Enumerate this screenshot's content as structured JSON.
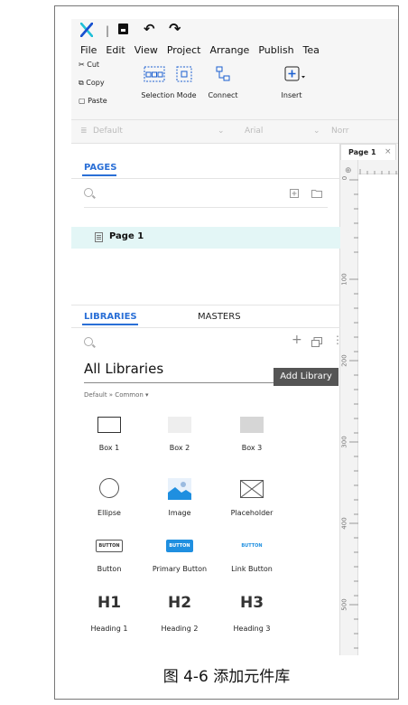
{
  "toolbar": {
    "separator": "|",
    "undo_glyph": "↶",
    "redo_glyph": "↷"
  },
  "menu": [
    "File",
    "Edit",
    "View",
    "Project",
    "Arrange",
    "Publish",
    "Tea"
  ],
  "clipboard": {
    "cut": "Cut",
    "copy": "Copy",
    "paste": "Paste"
  },
  "ribbon": {
    "selection_mode": "Selection Mode",
    "connect": "Connect",
    "insert": "Insert"
  },
  "format": {
    "style": "Default",
    "font": "Arial",
    "weight": "Norr"
  },
  "page_tab": {
    "label": "Page 1",
    "close": "×"
  },
  "pages": {
    "title": "PAGES",
    "items": [
      "Page 1"
    ]
  },
  "libraries": {
    "tab_libraries": "LIBRARIES",
    "tab_masters": "MASTERS",
    "add_glyph": "+",
    "more_glyph": "⋮",
    "tooltip": "Add Library",
    "selected": "All Libraries",
    "breadcrumb": "Default » Common ▾",
    "widgets": [
      {
        "label": "Box 1",
        "icon": "box-outline-icon"
      },
      {
        "label": "Box 2",
        "icon": "box-light-icon"
      },
      {
        "label": "Box 3",
        "icon": "box-dark-icon"
      },
      {
        "label": "Ellipse",
        "icon": "ellipse-icon"
      },
      {
        "label": "Image",
        "icon": "image-icon"
      },
      {
        "label": "Placeholder",
        "icon": "placeholder-icon"
      },
      {
        "label": "Button",
        "icon": "button-icon",
        "text": "BUTTON"
      },
      {
        "label": "Primary Button",
        "icon": "primary-button-icon",
        "text": "BUTTON"
      },
      {
        "label": "Link Button",
        "icon": "link-button-icon",
        "text": "BUTTON"
      },
      {
        "label": "Heading 1",
        "icon": "heading-1-icon",
        "text": "H1"
      },
      {
        "label": "Heading 2",
        "icon": "heading-2-icon",
        "text": "H2"
      },
      {
        "label": "Heading 3",
        "icon": "heading-3-icon",
        "text": "H3"
      }
    ]
  },
  "ruler": [
    "0",
    "100",
    "200",
    "300",
    "400",
    "500"
  ],
  "caption": "图 4-6 添加元件库",
  "colors": {
    "accent": "#2a6fd6",
    "selected_row": "#e3f6f6",
    "logo": "#20c0d8"
  }
}
